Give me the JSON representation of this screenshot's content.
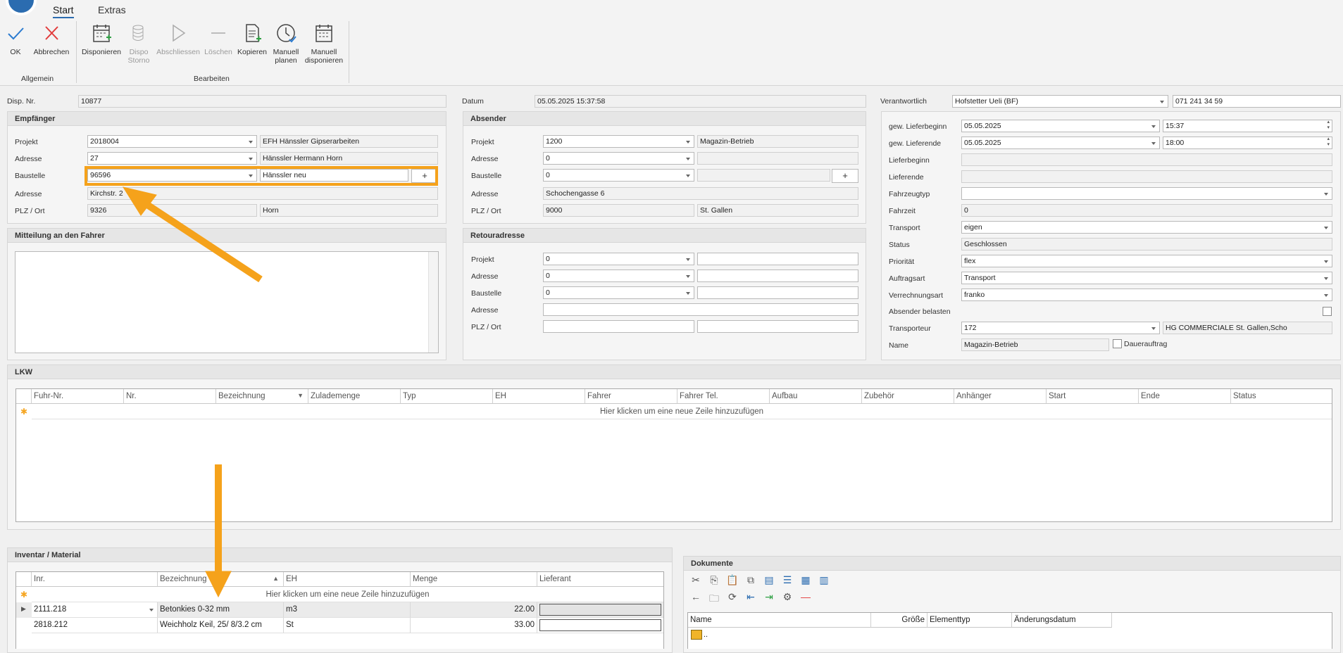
{
  "ribbon": {
    "tabs": [
      "Start",
      "Extras"
    ],
    "ok": "OK",
    "abbrechen": "Abbrechen",
    "group_allgemein": "Allgemein",
    "disponieren": "Disponieren",
    "dispo_storno_1": "Dispo",
    "dispo_storno_2": "Storno",
    "abschliessen": "Abschliessen",
    "loeschen": "Löschen",
    "kopieren": "Kopieren",
    "manuell_planen_1": "Manuell",
    "manuell_planen_2": "planen",
    "manuell_disponieren_1": "Manuell",
    "manuell_disponieren_2": "disponieren",
    "group_bearbeiten": "Bearbeiten"
  },
  "header": {
    "disp_nr_label": "Disp. Nr.",
    "disp_nr": "10877",
    "datum_label": "Datum",
    "datum": "05.05.2025 15:37:58",
    "verantwortlich_label": "Verantwortlich",
    "verantwortlich": "Hofstetter Ueli (BF)",
    "telefon": "071 241 34 59"
  },
  "empfaenger": {
    "title": "Empfänger",
    "projekt_label": "Projekt",
    "projekt": "2018004",
    "projekt_name": "EFH Hänssler Gipserarbeiten",
    "adresse_label": "Adresse",
    "adresse": "27",
    "adresse_name": "Hänssler Hermann Horn",
    "baustelle_label": "Baustelle",
    "baustelle": "96596",
    "baustelle_name": "Hänssler neu",
    "strasse_label": "Adresse",
    "strasse": "Kirchstr. 2",
    "plz_label": "PLZ / Ort",
    "plz": "9326",
    "ort": "Horn",
    "plus": "+"
  },
  "mitteilung": {
    "title": "Mitteilung an den Fahrer"
  },
  "absender": {
    "title": "Absender",
    "projekt_label": "Projekt",
    "projekt": "1200",
    "projekt_name": "Magazin-Betrieb",
    "adresse_label": "Adresse",
    "adresse": "0",
    "baustelle_label": "Baustelle",
    "baustelle": "0",
    "strasse_label": "Adresse",
    "strasse": "Schochengasse 6",
    "plz_label": "PLZ / Ort",
    "plz": "9000",
    "ort": "St. Gallen",
    "plus": "+"
  },
  "retour": {
    "title": "Retouradresse",
    "projekt_label": "Projekt",
    "projekt": "0",
    "adresse_label": "Adresse",
    "adresse": "0",
    "baustelle_label": "Baustelle",
    "baustelle": "0",
    "strasse_label": "Adresse",
    "plz_label": "PLZ / Ort"
  },
  "rechts": {
    "lieferbeginn_gew_label": "gew. Lieferbeginn",
    "lieferbeginn_gew_datum": "05.05.2025",
    "lieferbeginn_gew_zeit": "15:37",
    "lieferende_gew_label": "gew. Lieferende",
    "lieferende_gew_datum": "05.05.2025",
    "lieferende_gew_zeit": "18:00",
    "lieferbeginn_label": "Lieferbeginn",
    "lieferende_label": "Lieferende",
    "fahrzeugtyp_label": "Fahrzeugtyp",
    "fahrzeit_label": "Fahrzeit",
    "fahrzeit": "0",
    "transport_label": "Transport",
    "transport": "eigen",
    "status_label": "Status",
    "status": "Geschlossen",
    "prioritaet_label": "Priorität",
    "prioritaet": "flex",
    "auftragsart_label": "Auftragsart",
    "auftragsart": "Transport",
    "verrechnungsart_label": "Verrechnungsart",
    "verrechnungsart": "franko",
    "absender_belasten_label": "Absender belasten",
    "transporteur_label": "Transporteur",
    "transporteur": "172",
    "transporteur_name": "HG COMMERCIALE St. Gallen,Scho",
    "name_label": "Name",
    "name": "Magazin-Betrieb",
    "dauerauftrag_label": "Dauerauftrag"
  },
  "lkw": {
    "title": "LKW",
    "columns": [
      "Fuhr-Nr.",
      "Nr.",
      "Bezeichnung",
      "Zulademenge",
      "Typ",
      "EH",
      "Fahrer",
      "Fahrer Tel.",
      "Aufbau",
      "Zubehör",
      "Anhänger",
      "Start",
      "Ende",
      "Status"
    ],
    "new_row": "Hier klicken um eine neue Zeile hinzuzufügen"
  },
  "inventar": {
    "title": "Inventar / Material",
    "columns": [
      "Inr.",
      "Bezeichnung",
      "EH",
      "Menge",
      "Lieferant"
    ],
    "new_row": "Hier klicken um eine neue Zeile hinzuzufügen",
    "rows": [
      {
        "inr": "2111.218",
        "bez": "Betonkies 0-32 mm",
        "eh": "m3",
        "menge": "22.00"
      },
      {
        "inr": "2818.212",
        "bez": "Weichholz Keil, 25/ 8/3.2 cm",
        "eh": "St",
        "menge": "33.00"
      }
    ]
  },
  "dokumente": {
    "title": "Dokumente",
    "columns": [
      "Name",
      "Größe",
      "Elementtyp",
      "Änderungsdatum"
    ],
    "parent": ".."
  },
  "colors": {
    "highlight": "#f5a21b",
    "accent": "#2b6cb0"
  }
}
